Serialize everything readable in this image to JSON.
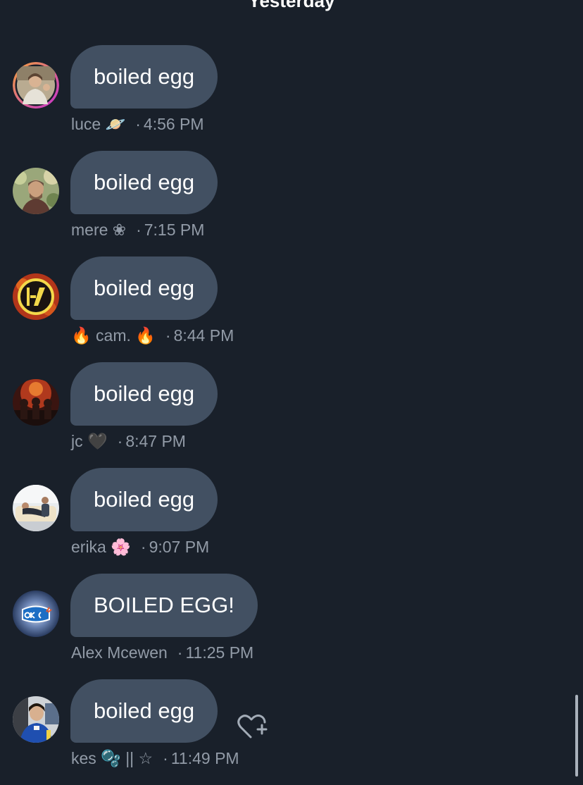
{
  "header": {
    "day_label": "Yesterday"
  },
  "messages": [
    {
      "text": "boiled egg",
      "author": "luce 🪐",
      "time": "4:56 PM"
    },
    {
      "text": "boiled egg",
      "author": "mere ❀",
      "time": "7:15 PM"
    },
    {
      "text": "boiled egg",
      "author": "🔥 cam. 🔥",
      "time": "8:44 PM"
    },
    {
      "text": "boiled egg",
      "author": "jc 🖤",
      "time": "8:47 PM"
    },
    {
      "text": "boiled egg",
      "author": "erika 🌸",
      "time": "9:07 PM"
    },
    {
      "text": "BOILED EGG!",
      "author": "Alex Mcewen",
      "time": "11:25 PM"
    },
    {
      "text": "boiled egg",
      "author": "kes 🫧 || ☆",
      "time": "11:49 PM"
    }
  ],
  "separator": "·",
  "icons": {
    "reaction": "heart-plus-icon"
  },
  "colors": {
    "background": "#19202a",
    "bubble": "#425062",
    "meta_text": "#929ba7"
  }
}
